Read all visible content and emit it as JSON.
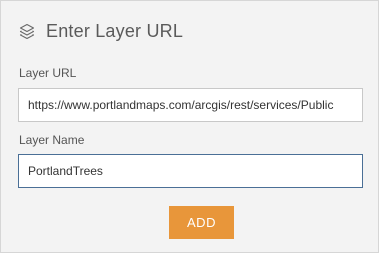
{
  "header": {
    "icon": "layers-icon",
    "title": "Enter Layer URL"
  },
  "layer_url": {
    "label": "Layer URL",
    "value": "https://www.portlandmaps.com/arcgis/rest/services/Public"
  },
  "layer_name": {
    "label": "Layer Name",
    "value": "PortlandTrees"
  },
  "actions": {
    "add_label": "ADD"
  },
  "colors": {
    "accent": "#e8963a",
    "focus_border": "#4a6f96",
    "panel_background": "#f3f3f3"
  }
}
